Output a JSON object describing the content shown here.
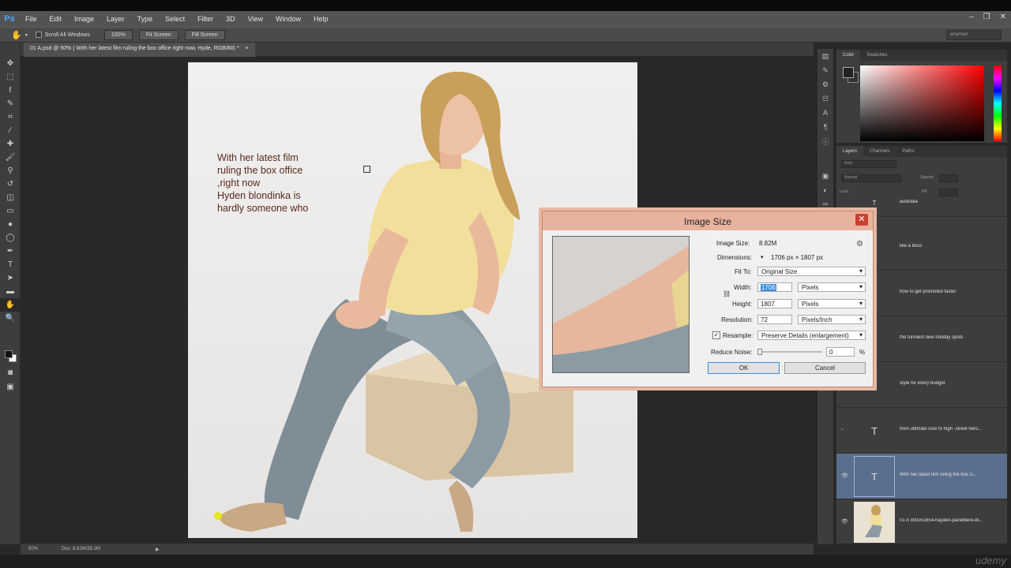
{
  "app": {
    "logo": "Ps",
    "menu": [
      "File",
      "Edit",
      "Image",
      "Layer",
      "Type",
      "Select",
      "Filter",
      "3D",
      "View",
      "Window",
      "Help"
    ],
    "window_controls": [
      "–",
      "❐",
      "✕"
    ]
  },
  "options_bar": {
    "scroll_all_windows": "Scroll All Windows",
    "zoom_100": "100%",
    "fit_screen": "Fit Screen",
    "fill_screen": "Fill Screen",
    "workspace": "ahamed"
  },
  "document": {
    "tab_label": "01 A.psd @ 50% (   With her latest film ruling the box office right now, Hyde, RGB/8#) *",
    "tab_close": "×",
    "canvas_text": [
      "With her latest film",
      "ruling the box office",
      ",right now",
      "Hyden blondinka is",
      "hardly someone who"
    ]
  },
  "status_bar": {
    "zoom": "50%",
    "doc_size": "Doc: 8.82M/35.2M"
  },
  "color_panel": {
    "tabs": [
      "Color",
      "Swatches"
    ]
  },
  "layers_panel": {
    "tabs": [
      "Layers",
      "Channels",
      "Paths"
    ],
    "kind_filter": "Kind",
    "blend_mode": "Normal",
    "opacity_label": "Opacity:",
    "lock_label": "Lock:",
    "fill_label": "Fill:",
    "layers": [
      {
        "name": "australia",
        "thumb": "T"
      },
      {
        "name": "like a boss",
        "thumb": ""
      },
      {
        "name": "how to get promoted faster",
        "thumb": ""
      },
      {
        "name": "the funniest new holiday spots",
        "thumb": ""
      },
      {
        "name": "style for every budget",
        "thumb": ""
      },
      {
        "name": "from ultimate luxe to high -street hero...",
        "thumb": "T"
      },
      {
        "name": "With her latest film ruling the box o...",
        "thumb": "T"
      },
      {
        "name": "01 A 3000x1854-hayden-panettiere-bl...",
        "thumb": ""
      }
    ]
  },
  "image_size_dialog": {
    "title": "Image Size",
    "close": "✕",
    "image_size_label": "Image Size:",
    "image_size_value": "8.82M",
    "dimensions_label": "Dimensions:",
    "dimensions_value": "1706 px  ×  1807 px",
    "fit_to_label": "Fit To:",
    "fit_to_value": "Original Size",
    "width_label": "Width:",
    "width_value": "1706",
    "width_unit": "Pixels",
    "height_label": "Height:",
    "height_value": "1807",
    "height_unit": "Pixels",
    "resolution_label": "Resolution:",
    "resolution_value": "72",
    "resolution_unit": "Pixels/Inch",
    "resample_label": "Resample:",
    "resample_value": "Preserve Details (enlargement)",
    "reduce_noise_label": "Reduce Noise:",
    "reduce_noise_value": "0",
    "reduce_noise_unit": "%",
    "ok": "OK",
    "cancel": "Cancel"
  },
  "watermark": "udemy"
}
